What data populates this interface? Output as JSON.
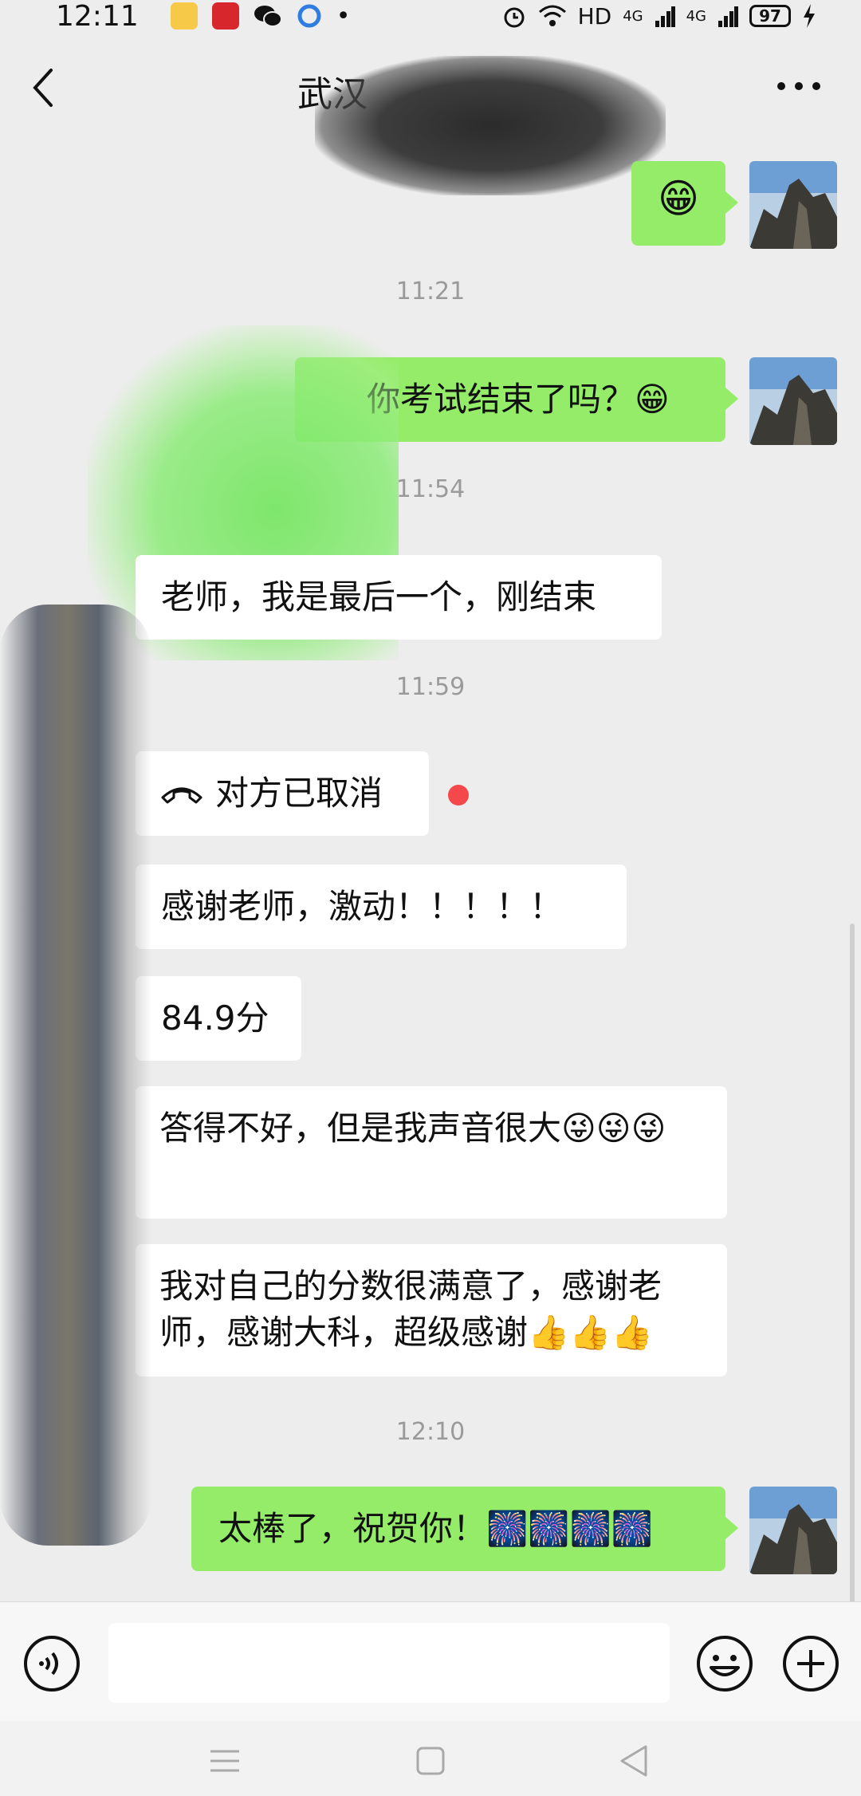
{
  "status_bar": {
    "time": "12:11",
    "network": "HD",
    "signal1": "4G",
    "signal2": "4G",
    "battery": "97"
  },
  "header": {
    "title": "武汉",
    "back_icon": "chevron-left-icon",
    "more_icon": "more-dots-icon"
  },
  "messages": [
    {
      "side": "me",
      "type": "emoji",
      "text": "😁"
    },
    {
      "type": "time",
      "text": "11:21"
    },
    {
      "side": "me",
      "type": "text",
      "text": "你考试结束了吗？😁"
    },
    {
      "type": "time",
      "text": "11:54"
    },
    {
      "side": "them",
      "type": "text",
      "text": "老师，我是最后一个，刚结束"
    },
    {
      "type": "time",
      "text": "11:59"
    },
    {
      "side": "them",
      "type": "call",
      "text": "对方已取消",
      "icon": "phone-hangup-icon"
    },
    {
      "side": "them",
      "type": "text",
      "text": "感谢老师，激动！！！！！"
    },
    {
      "side": "them",
      "type": "text",
      "text": "84.9分"
    },
    {
      "side": "them",
      "type": "text",
      "text": "答得不好，但是我声音很大😜😜😜"
    },
    {
      "side": "them",
      "type": "text",
      "text": "我对自己的分数很满意了，感谢老师，感谢大科，超级感谢👍👍👍"
    },
    {
      "type": "time",
      "text": "12:10"
    },
    {
      "side": "me",
      "type": "text",
      "text": "太棒了，祝贺你！🎆🎆🎆🎆"
    }
  ],
  "input_bar": {
    "voice_icon": "voice-icon",
    "emoji_icon": "smiley-icon",
    "plus_icon": "plus-circle-icon",
    "value": ""
  },
  "nav_bar": {
    "menu_icon": "menu-icon",
    "home_icon": "home-square-icon",
    "back_icon": "back-triangle-icon"
  },
  "colors": {
    "background": "#ededed",
    "me_bubble": "#95ec69",
    "them_bubble": "#ffffff",
    "unread_dot": "#f4484a"
  }
}
